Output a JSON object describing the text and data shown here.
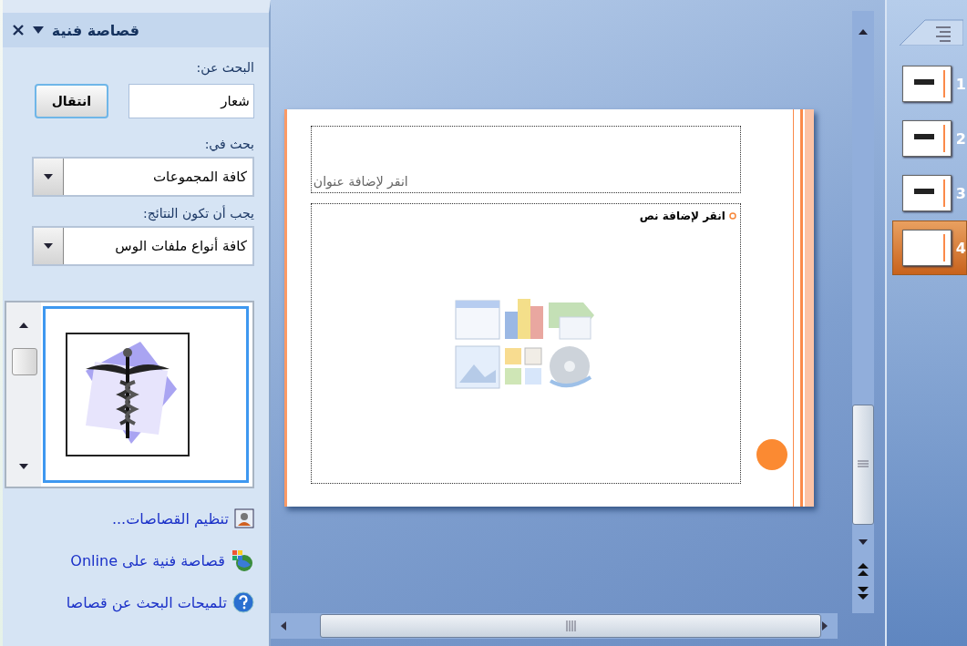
{
  "task_pane": {
    "title": "قصاصة فنية",
    "search_label": "البحث عن:",
    "search_value": "شعار",
    "go_button": "انتقال",
    "search_in_label": "بحث في:",
    "search_in_value": "كافة المجموعات",
    "results_label": "يجب أن تكون النتائج:",
    "results_value": "كافة أنواع ملفات الوس",
    "links": [
      {
        "kind": "organize",
        "label": "تنظيم القصاصات..."
      },
      {
        "kind": "online",
        "label": "قصاصة فنية على Online"
      },
      {
        "kind": "help",
        "label": "تلميحات البحث عن قصاصا"
      }
    ]
  },
  "slide": {
    "title_placeholder": "انقر لإضافة عنوان",
    "text_placeholder": "انقر لإضافة نص"
  },
  "thumbnails": [
    {
      "number": "1",
      "selected": false
    },
    {
      "number": "2",
      "selected": false
    },
    {
      "number": "3",
      "selected": false
    },
    {
      "number": "4",
      "selected": true
    }
  ]
}
